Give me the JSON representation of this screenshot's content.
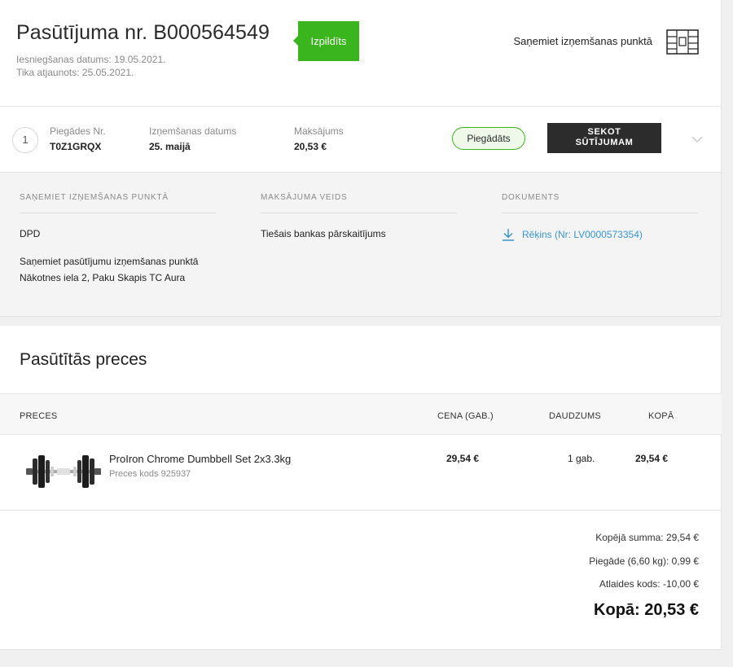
{
  "order": {
    "title": "Pasūtījuma nr. B000564549",
    "status": "Izpildīts",
    "submitted": "Iesniegšanas datums: 19.05.2021.",
    "updated": "Tika atjaunots: 25.05.2021.",
    "pickup_title": "Saņemiet izņemšanas punktā"
  },
  "shipment": {
    "index": "1",
    "number_label": "Piegādes Nr.",
    "number_value": "T0Z1GRQX",
    "pickup_date_label": "Izņemšanas datums",
    "pickup_date_value": "25. maijā",
    "payment_label": "Maksājums",
    "payment_value": "20,53 €",
    "status_badge": "Piegādāts",
    "track_button_line1": "SEKOT",
    "track_button_line2": "SŪTĪJUMAM"
  },
  "details": {
    "pickup_heading": "SAŅEMIET IZŅEMŠANAS PUNKTĀ",
    "carrier": "DPD",
    "pickup_line1": "Saņemiet pasūtījumu izņemšanas punktā",
    "pickup_line2": "Nākotnes iela 2, Paku Skapis TC Aura",
    "payment_heading": "MAKSĀJUMA VEIDS",
    "payment_method": "Tiešais bankas pārskaitījums",
    "document_heading": "DOKUMENTS",
    "invoice_link": "Rēķins (Nr: LV0000573354)"
  },
  "items": {
    "section_title": "Pasūtītās preces",
    "columns": {
      "product": "PRECES",
      "price": "CENA (GAB.)",
      "quantity": "DAUDZUMS",
      "total": "KOPĀ"
    },
    "rows": [
      {
        "name": "ProIron Chrome Dumbbell Set 2x3.3kg",
        "code": "Preces kods 925937",
        "price": "29,54 €",
        "quantity": "1 gab.",
        "total": "29,54 €"
      }
    ]
  },
  "summary": {
    "subtotal": "Kopējā summa: 29,54 €",
    "delivery": "Piegāde (6,60 kg): 0,99 €",
    "discount": "Atlaides kods: -10,00 €",
    "grand_total": "Kopā: 20,53 €"
  },
  "colors": {
    "accent_green": "#3bb51d",
    "link_blue": "#3a94d0",
    "button_dark": "#2c2c2c"
  },
  "icons": {
    "locker": "parcel-locker-icon",
    "chevron": "chevron-down-icon",
    "download": "download-icon"
  }
}
